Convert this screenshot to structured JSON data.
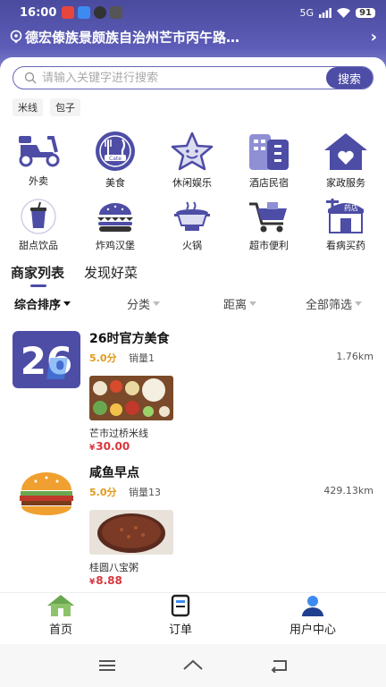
{
  "status_bar": {
    "time": "16:00",
    "battery": "91",
    "network": "5G"
  },
  "location": {
    "text": "德宏傣族景颇族自治州芒市丙午路…",
    "arrow": "›"
  },
  "search": {
    "placeholder": "请输入关键字进行搜索",
    "button_label": "搜索"
  },
  "hot_tags": [
    "米线",
    "包子"
  ],
  "categories": [
    {
      "label": "外卖",
      "icon": "scooter-icon"
    },
    {
      "label": "美食",
      "icon": "cate-icon"
    },
    {
      "label": "休闲娱乐",
      "icon": "star-icon"
    },
    {
      "label": "酒店民宿",
      "icon": "hotel-icon"
    },
    {
      "label": "家政服务",
      "icon": "house-heart-icon"
    },
    {
      "label": "甜点饮品",
      "icon": "drink-icon"
    },
    {
      "label": "炸鸡汉堡",
      "icon": "burger-icon"
    },
    {
      "label": "火锅",
      "icon": "hotpot-icon"
    },
    {
      "label": "超市便利",
      "icon": "cart-icon"
    },
    {
      "label": "看病买药",
      "icon": "pharmacy-icon"
    }
  ],
  "pharmacy_sign": "药店",
  "cate_badge": "Cate",
  "tabs": [
    {
      "label": "商家列表",
      "active": true
    },
    {
      "label": "发现好菜",
      "active": false
    }
  ],
  "filters": [
    {
      "label": "综合排序",
      "active": true
    },
    {
      "label": "分类",
      "active": false
    },
    {
      "label": "距离",
      "active": false
    },
    {
      "label": "全部筛选",
      "active": false
    }
  ],
  "shops": [
    {
      "name": "26时官方美食",
      "score": "5.0分",
      "sales": "销量1",
      "distance": "1.76km",
      "logo_text": "26",
      "dish": {
        "name": "芒市过桥米线",
        "price_symbol": "¥",
        "price": "30.00"
      }
    },
    {
      "name": "咸鱼早点",
      "score": "5.0分",
      "sales": "销量13",
      "distance": "429.13km",
      "dish": {
        "name": "桂圆八宝粥",
        "price_symbol": "¥",
        "price": "8.88"
      }
    }
  ],
  "bottom_nav": [
    {
      "label": "首页",
      "icon": "home-icon"
    },
    {
      "label": "订单",
      "icon": "order-icon"
    },
    {
      "label": "用户中心",
      "icon": "user-icon"
    }
  ],
  "colors": {
    "brand": "#4d4da6",
    "price": "#d9363e",
    "score": "#e09a1a"
  }
}
